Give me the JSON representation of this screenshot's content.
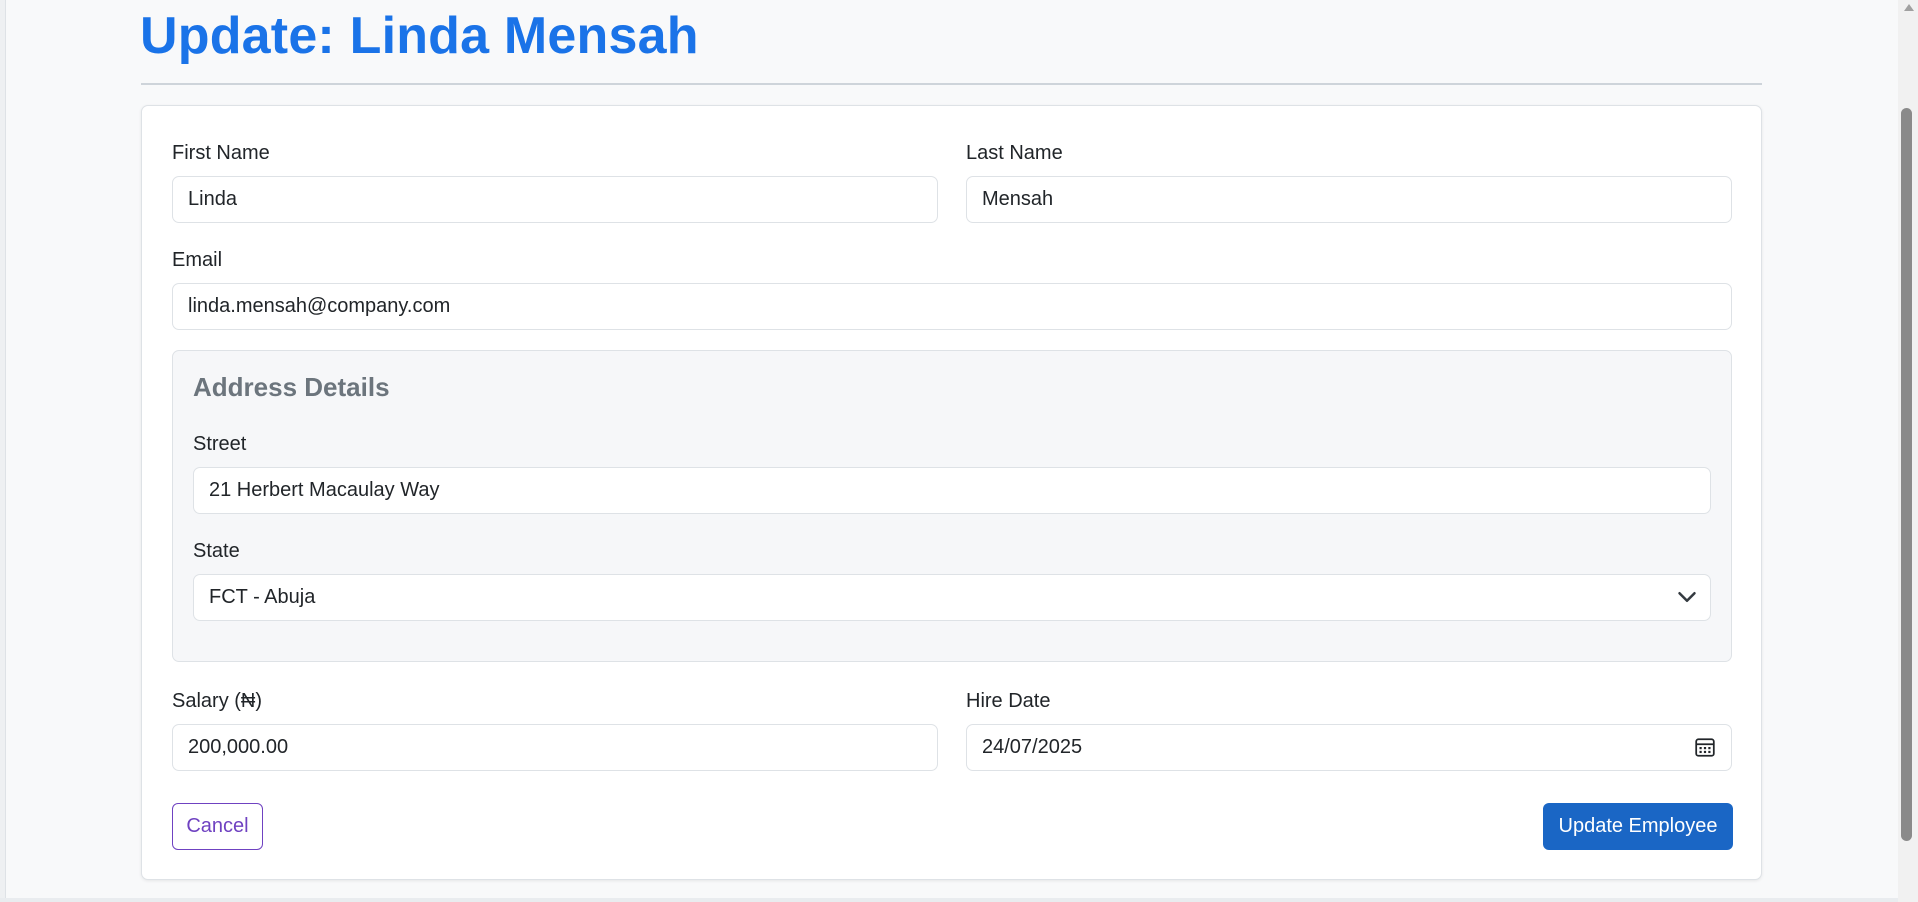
{
  "page": {
    "title": "Update: Linda Mensah"
  },
  "form": {
    "first_name": {
      "label": "First Name",
      "value": "Linda"
    },
    "last_name": {
      "label": "Last Name",
      "value": "Mensah"
    },
    "email": {
      "label": "Email",
      "value": "linda.mensah@company.com"
    },
    "address": {
      "legend": "Address Details",
      "street": {
        "label": "Street",
        "value": "21 Herbert Macaulay Way"
      },
      "state": {
        "label": "State",
        "value": "FCT - Abuja",
        "icon": "chevron-down-icon"
      }
    },
    "salary": {
      "label": "Salary (₦)",
      "value": "200,000.00"
    },
    "hire_date": {
      "label": "Hire Date",
      "value": "24/07/2025",
      "icon": "calendar-icon"
    }
  },
  "actions": {
    "cancel_label": "Cancel",
    "update_label": "Update Employee"
  },
  "colors": {
    "title": "#1a73e8",
    "primary_button": "#1a66c5",
    "cancel_outline": "#6f42c1"
  }
}
